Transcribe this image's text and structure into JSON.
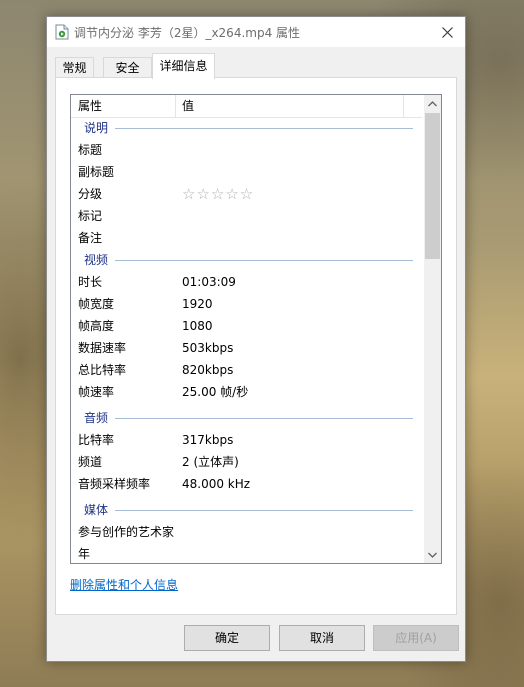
{
  "window": {
    "title": "调节内分泌 李芳（2星）_x264.mp4 属性"
  },
  "tabs": [
    {
      "label": "常规"
    },
    {
      "label": "安全"
    },
    {
      "label": "详细信息"
    }
  ],
  "list": {
    "header": {
      "property": "属性",
      "value": "值"
    },
    "groups": {
      "description": "说明",
      "video": "视频",
      "audio": "音频",
      "media": "媒体"
    },
    "rows": {
      "title": {
        "name": "标题",
        "value": ""
      },
      "subtitle": {
        "name": "副标题",
        "value": ""
      },
      "rating": {
        "name": "分级",
        "value": "☆☆☆☆☆",
        "stars": 0,
        "max": 5
      },
      "tags": {
        "name": "标记",
        "value": ""
      },
      "comments": {
        "name": "备注",
        "value": ""
      },
      "length": {
        "name": "时长",
        "value": "01:03:09"
      },
      "frame_width": {
        "name": "帧宽度",
        "value": "1920"
      },
      "frame_height": {
        "name": "帧高度",
        "value": "1080"
      },
      "data_rate": {
        "name": "数据速率",
        "value": "503kbps"
      },
      "total_bitrate": {
        "name": "总比特率",
        "value": "820kbps"
      },
      "frame_rate": {
        "name": "帧速率",
        "value": "25.00 帧/秒"
      },
      "audio_bitrate": {
        "name": "比特率",
        "value": "317kbps"
      },
      "channels": {
        "name": "频道",
        "value": "2 (立体声)"
      },
      "sample_rate": {
        "name": "音频采样频率",
        "value": "48.000 kHz"
      },
      "contributing_artists": {
        "name": "参与创作的艺术家",
        "value": ""
      },
      "year": {
        "name": "年",
        "value": ""
      }
    }
  },
  "links": {
    "remove_properties": "删除属性和个人信息"
  },
  "buttons": {
    "ok": "确定",
    "cancel": "取消",
    "apply": "应用(A)"
  },
  "colors": {
    "group_header": "#1e3287",
    "link": "#0066cc"
  }
}
